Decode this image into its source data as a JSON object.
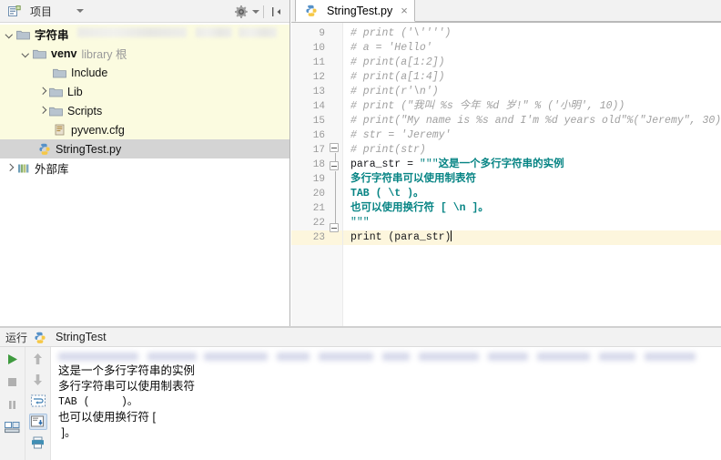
{
  "project_panel": {
    "header": {
      "title": "项目",
      "icons": [
        "project-view-icon",
        "chevron-down-icon",
        "gear-icon",
        "collapse-all-icon"
      ]
    },
    "tree": [
      {
        "label": "字符串",
        "sublabel": "",
        "icon": "folder-icon",
        "arrow": "down",
        "indent": 0,
        "bold": true,
        "highlight": "yellow"
      },
      {
        "label": "venv",
        "sublabel": "library 根",
        "icon": "folder-icon",
        "arrow": "down",
        "indent": 1,
        "bold": true,
        "highlight": "yellow"
      },
      {
        "label": "Include",
        "sublabel": "",
        "icon": "folder-icon",
        "arrow": "none",
        "indent": 2,
        "bold": false,
        "highlight": "yellow"
      },
      {
        "label": "Lib",
        "sublabel": "",
        "icon": "folder-icon",
        "arrow": "right",
        "indent": 2,
        "bold": false,
        "highlight": "yellow"
      },
      {
        "label": "Scripts",
        "sublabel": "",
        "icon": "folder-icon",
        "arrow": "right",
        "indent": 2,
        "bold": false,
        "highlight": "yellow"
      },
      {
        "label": "pyvenv.cfg",
        "sublabel": "",
        "icon": "config-file-icon",
        "arrow": "none",
        "indent": 2,
        "bold": false,
        "highlight": "yellow"
      },
      {
        "label": "StringTest.py",
        "sublabel": "",
        "icon": "python-file-icon",
        "arrow": "none",
        "indent": 1,
        "bold": false,
        "highlight": "selected"
      },
      {
        "label": "外部库",
        "sublabel": "",
        "icon": "external-libraries-icon",
        "arrow": "right",
        "indent": 0,
        "bold": false,
        "highlight": "none"
      }
    ]
  },
  "editor": {
    "tab": {
      "label": "StringTest.py",
      "icon": "python-file-icon",
      "close": "×"
    },
    "cursor_line": 23,
    "lines": [
      {
        "n": "9",
        "tokens": [
          {
            "t": "# print ('\\'''')",
            "c": "cmt"
          }
        ]
      },
      {
        "n": "10",
        "tokens": [
          {
            "t": "# a = 'Hello'",
            "c": "cmt"
          }
        ]
      },
      {
        "n": "11",
        "tokens": [
          {
            "t": "# print(a[1:2])",
            "c": "cmt"
          }
        ]
      },
      {
        "n": "12",
        "tokens": [
          {
            "t": "# print(a[1:4])",
            "c": "cmt"
          }
        ]
      },
      {
        "n": "13",
        "tokens": [
          {
            "t": "# print(r'\\n')",
            "c": "cmt"
          }
        ]
      },
      {
        "n": "14",
        "tokens": [
          {
            "t": "# print (\"我叫 %s 今年 %d 岁!\" % ('小明', 10))",
            "c": "cmt"
          }
        ]
      },
      {
        "n": "15",
        "tokens": [
          {
            "t": "# print(\"My name is %s and I'm %d years old\"%(\"Jeremy\", 30))",
            "c": "cmt"
          }
        ]
      },
      {
        "n": "16",
        "tokens": [
          {
            "t": "# str = 'Jeremy'",
            "c": "cmt"
          }
        ]
      },
      {
        "n": "17",
        "tokens": [
          {
            "t": "# print(str)",
            "c": "cmt"
          }
        ]
      },
      {
        "n": "18",
        "tokens": [
          {
            "t": "para_str = ",
            "c": "plain"
          },
          {
            "t": "\"\"\"",
            "c": "strq"
          },
          {
            "t": "这是一个多行字符串的实例",
            "c": "str"
          }
        ]
      },
      {
        "n": "19",
        "tokens": [
          {
            "t": "多行字符串可以使用制表符",
            "c": "str"
          }
        ]
      },
      {
        "n": "20",
        "tokens": [
          {
            "t": "TAB ( \\t )。",
            "c": "str"
          }
        ]
      },
      {
        "n": "21",
        "tokens": [
          {
            "t": "也可以使用换行符 [ \\n ]。",
            "c": "str"
          }
        ]
      },
      {
        "n": "22",
        "tokens": [
          {
            "t": "\"\"\"",
            "c": "strq"
          }
        ]
      },
      {
        "n": "23",
        "tokens": [
          {
            "t": "print (para_str)",
            "c": "plain"
          }
        ]
      }
    ]
  },
  "run_panel": {
    "title": "运行",
    "config_name": "StringTest",
    "tools_left": [
      "run-icon",
      "stop-icon",
      "pause-icon",
      "layout-icon"
    ],
    "tools_right": [
      "arrow-up-icon",
      "arrow-down-icon",
      "soft-wrap-icon",
      "scroll-to-end-icon",
      "print-icon"
    ],
    "output": [
      "这是一个多行字符串的实例",
      "多行字符串可以使用制表符",
      "TAB (     )。",
      "也可以使用换行符 [",
      " ]。"
    ]
  },
  "colors": {
    "string_teal": "#068484",
    "comment_grey": "#a0a0a0",
    "tree_highlight": "#fbfbe0",
    "tree_selected": "#d4d4d4",
    "current_line": "#fdf6dd",
    "run_green": "#3f9b3f"
  }
}
